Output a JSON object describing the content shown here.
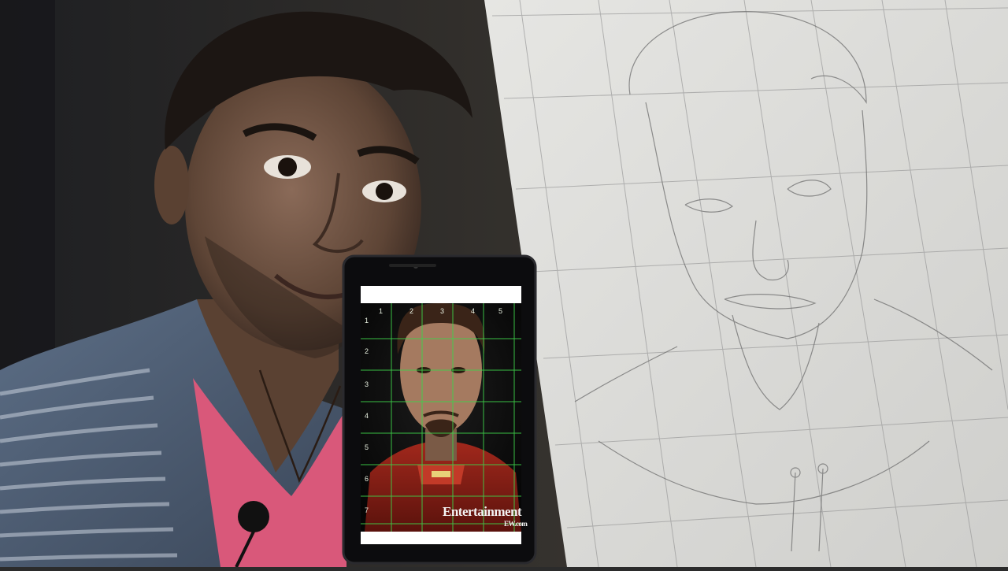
{
  "phone": {
    "grid_columns": [
      "1",
      "2",
      "3",
      "4",
      "5"
    ],
    "grid_rows": [
      "1",
      "2",
      "3",
      "4",
      "5",
      "6",
      "7"
    ],
    "watermark": "Entertainment",
    "watermark_sub": "EW.com"
  },
  "colors": {
    "grid_line": "#3ed24a",
    "shirt_pink": "#d9587a",
    "denim": "#47566c",
    "paper": "#dcdcd9",
    "iron_red": "#8a1c14"
  }
}
